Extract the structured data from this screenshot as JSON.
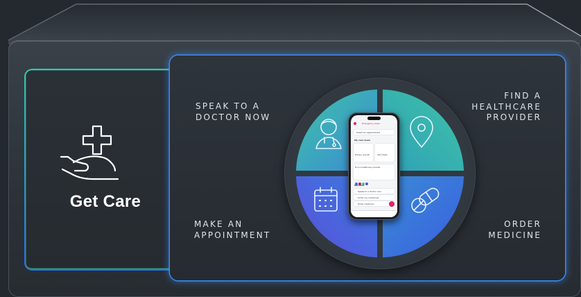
{
  "left_card": {
    "title": "Get Care",
    "icon": "hand-with-medical-cross-icon",
    "accent_top": "#38c4a8",
    "accent_bottom": "#2a6fd6"
  },
  "panel": {
    "glow_color": "#3d8cf0",
    "labels": {
      "top_left": [
        "SPEAK TO A",
        "DOCTOR NOW"
      ],
      "top_right": [
        "FIND A",
        "HEALTHCARE",
        "PROVIDER"
      ],
      "bottom_left": [
        "MAKE AN",
        "APPOINTMENT"
      ],
      "bottom_right": [
        "ORDER",
        "MEDICINE"
      ]
    }
  },
  "quadrants": [
    {
      "name": "doctor",
      "icon": "doctor-icon"
    },
    {
      "name": "location",
      "icon": "location-pin-icon"
    },
    {
      "name": "appointment",
      "icon": "calendar-icon"
    },
    {
      "name": "medicine",
      "icon": "pills-icon"
    }
  ],
  "colors": {
    "gradient_teal": "#3fc3a6",
    "gradient_blue": "#3a6fe0",
    "gradient_purple": "#5a4fd8"
  },
  "phone_screen": {
    "banner": "Emergency exam",
    "select_appointment": "Select an appointment",
    "care_team_heading": "My care team",
    "cards": [
      "Primary care GP",
      "Add a team"
    ],
    "find_provider": "Find a healthcare provider",
    "services_heading": "Services",
    "services": [
      "Speak to a doctor now",
      "Order my medicines",
      "Order medicine"
    ]
  }
}
